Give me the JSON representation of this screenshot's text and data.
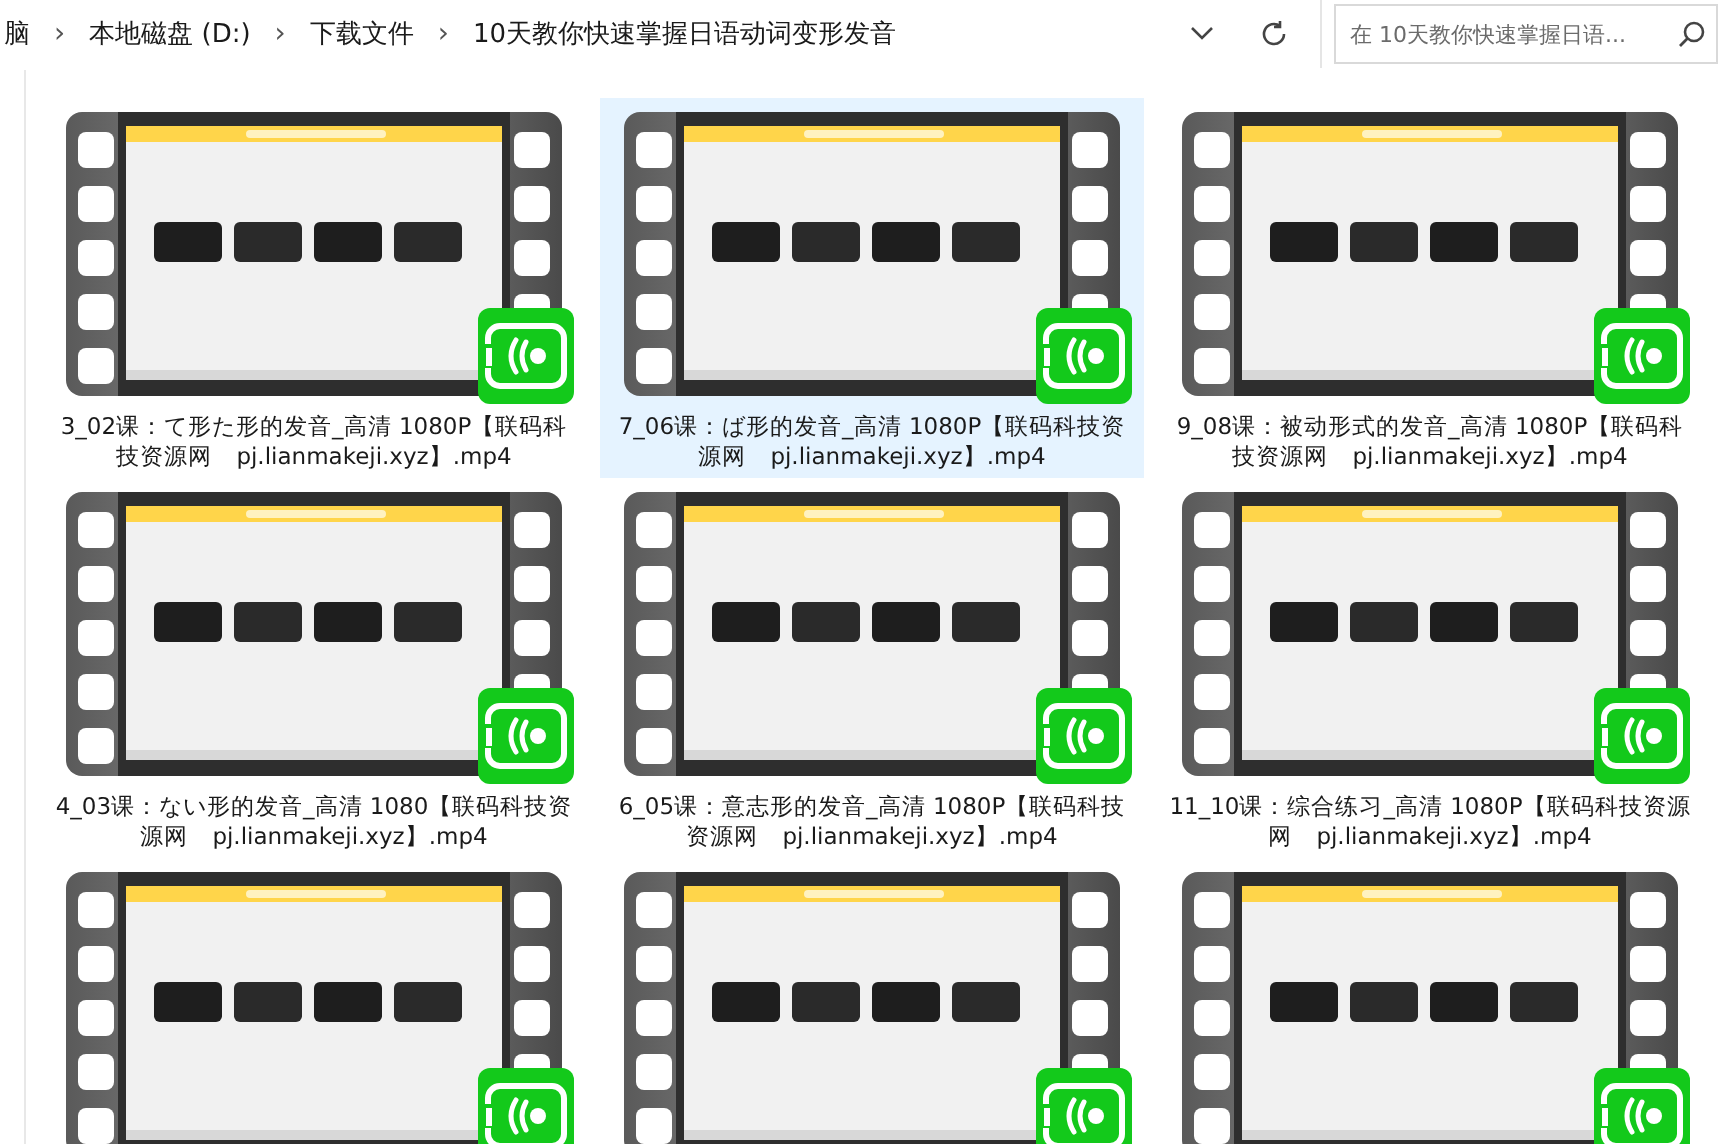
{
  "address_bar": {
    "crumbs": [
      "脑",
      "本地磁盘 (D:)",
      "下载文件",
      "10天教你快速掌握日语动词变形发音"
    ],
    "separator": "›"
  },
  "search": {
    "placeholder": "在 10天教你快速掌握日语..."
  },
  "files": [
    {
      "label": "3_02课：て形た形的发音_高清 1080P【联码科技资源网　pj.lianmakeji.xyz】.mp4",
      "selected": false
    },
    {
      "label": "7_06课：ば形的发音_高清 1080P【联码科技资源网　pj.lianmakeji.xyz】.mp4",
      "selected": true
    },
    {
      "label": "9_08课：被动形式的发音_高清 1080P【联码科技资源网　pj.lianmakeji.xyz】.mp4",
      "selected": false
    },
    {
      "label": "4_03课：ない形的发音_高清 1080【联码科技资源网　pj.lianmakeji.xyz】.mp4",
      "selected": false
    },
    {
      "label": "6_05课：意志形的发音_高清 1080P【联码科技资源网　pj.lianmakeji.xyz】.mp4",
      "selected": false
    },
    {
      "label": "11_10课：综合练习_高清 1080P【联码科技资源网　pj.lianmakeji.xyz】.mp4",
      "selected": false
    },
    {
      "selected": false
    },
    {
      "selected": false
    },
    {
      "selected": false
    }
  ]
}
